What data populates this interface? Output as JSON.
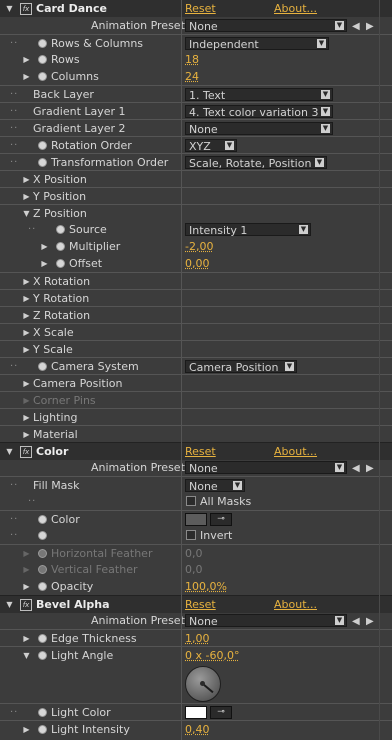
{
  "effects": [
    {
      "name": "Card Dance",
      "reset": "Reset",
      "about": "About..."
    },
    {
      "name": "Color",
      "reset": "Reset",
      "about": "About..."
    },
    {
      "name": "Bevel Alpha",
      "reset": "Reset",
      "about": "About..."
    }
  ],
  "common": {
    "animation_presets_label": "Animation Presets:",
    "animation_presets_value": "None"
  },
  "card_dance": {
    "rows_columns": {
      "label": "Rows & Columns",
      "value": "Independent"
    },
    "rows": {
      "label": "Rows",
      "value": "18"
    },
    "columns": {
      "label": "Columns",
      "value": "24"
    },
    "back_layer": {
      "label": "Back Layer",
      "value": "1. Text"
    },
    "gradient_layer_1": {
      "label": "Gradient Layer 1",
      "value": "4. Text color variation 3"
    },
    "gradient_layer_2": {
      "label": "Gradient Layer 2",
      "value": "None"
    },
    "rotation_order": {
      "label": "Rotation Order",
      "value": "XYZ"
    },
    "transformation_order": {
      "label": "Transformation Order",
      "value": "Scale, Rotate, Position"
    },
    "x_position": "X Position",
    "y_position": "Y Position",
    "z_position": "Z Position",
    "source": {
      "label": "Source",
      "value": "Intensity 1"
    },
    "multiplier": {
      "label": "Multiplier",
      "value": "-2,00"
    },
    "offset": {
      "label": "Offset",
      "value": "0,00"
    },
    "x_rotation": "X Rotation",
    "y_rotation": "Y Rotation",
    "z_rotation": "Z Rotation",
    "x_scale": "X Scale",
    "y_scale": "Y Scale",
    "camera_system": {
      "label": "Camera System",
      "value": "Camera Position"
    },
    "camera_position": "Camera Position",
    "corner_pins": "Corner Pins",
    "lighting": "Lighting",
    "material": "Material"
  },
  "color": {
    "fill_mask": {
      "label": "Fill Mask",
      "value": "None"
    },
    "all_masks": "All Masks",
    "color": {
      "label": "Color"
    },
    "invert": "Invert",
    "horizontal_feather": {
      "label": "Horizontal Feather",
      "value": "0,0"
    },
    "vertical_feather": {
      "label": "Vertical Feather",
      "value": "0,0"
    },
    "opacity": {
      "label": "Opacity",
      "value": "100,0%"
    }
  },
  "bevel_alpha": {
    "edge_thickness": {
      "label": "Edge Thickness",
      "value": "1,00"
    },
    "light_angle": {
      "label": "Light Angle",
      "value": "0 x -60,0°"
    },
    "light_color": {
      "label": "Light Color"
    },
    "light_intensity": {
      "label": "Light Intensity",
      "value": "0,40"
    }
  },
  "colors": {
    "accent": "#e7b23f",
    "bg": "#3c3c3c",
    "header_bg": "#2f2f2f",
    "field_bg": "#2b2b2b",
    "swatch_color": "#5c5c5c",
    "swatch_light": "#ffffff"
  }
}
